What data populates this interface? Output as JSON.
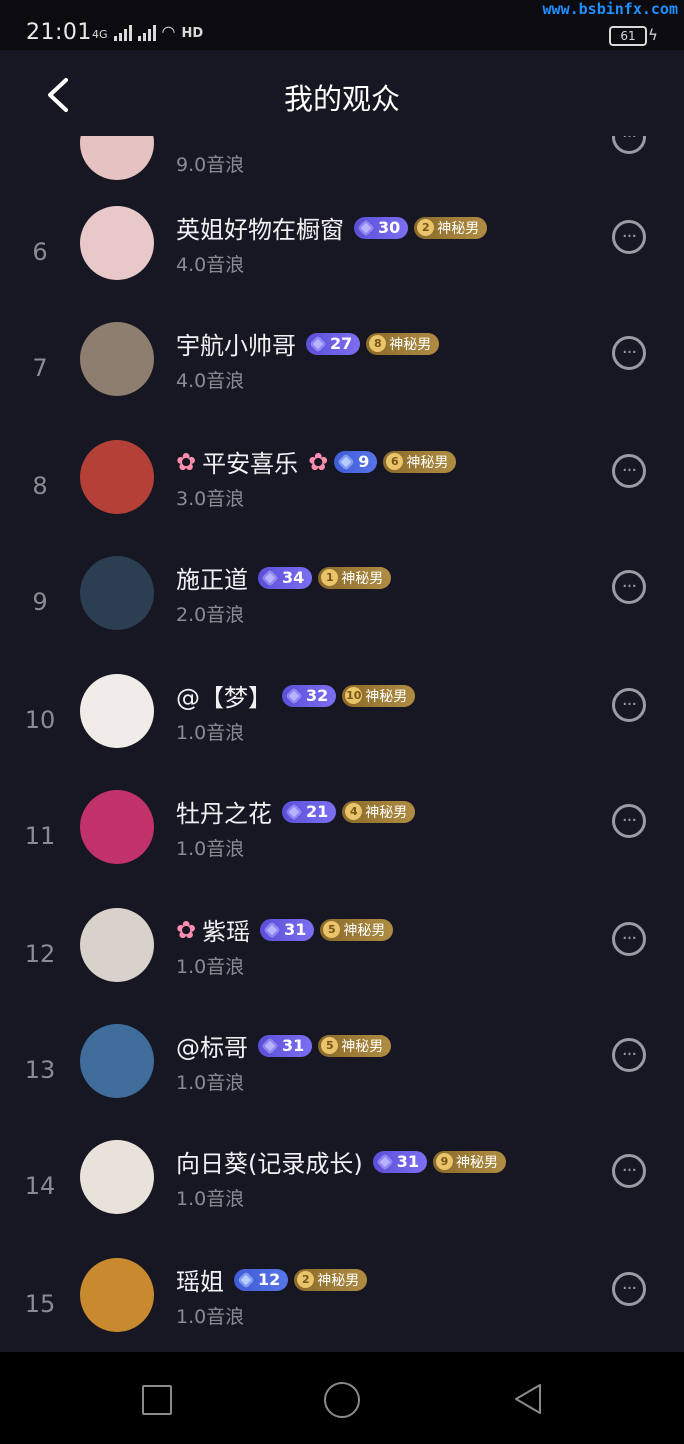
{
  "status": {
    "time": "21:01",
    "network": "4G",
    "battery": "61",
    "hd": "HD",
    "watermark": "www.bsbinfx.com"
  },
  "header": {
    "title": "我的观众"
  },
  "partial_row": {
    "amount": "9.0音浪"
  },
  "rows": [
    {
      "rank": "6",
      "name": "英姐好物在橱窗",
      "level": "30",
      "fan_level": "2",
      "fan_label": "神秘男",
      "amount": "4.0音浪",
      "flower_before": false,
      "flower_after": false,
      "level_style": "purple",
      "avatar_color": "#e8c8c8"
    },
    {
      "rank": "7",
      "name": "宇航小帅哥",
      "level": "27",
      "fan_level": "8",
      "fan_label": "神秘男",
      "amount": "4.0音浪",
      "flower_before": false,
      "flower_after": false,
      "level_style": "purple",
      "avatar_color": "#8e7e70"
    },
    {
      "rank": "8",
      "name": "平安喜乐",
      "level": "9",
      "fan_level": "6",
      "fan_label": "神秘男",
      "amount": "3.0音浪",
      "flower_before": true,
      "flower_after": true,
      "level_style": "blue",
      "avatar_color": "#b54038"
    },
    {
      "rank": "9",
      "name": "施正道",
      "level": "34",
      "fan_level": "1",
      "fan_label": "神秘男",
      "amount": "2.0音浪",
      "flower_before": false,
      "flower_after": false,
      "level_style": "purple",
      "avatar_color": "#2c3e52"
    },
    {
      "rank": "10",
      "name": "@【梦】",
      "level": "32",
      "fan_level": "10",
      "fan_label": "神秘男",
      "amount": "1.0音浪",
      "flower_before": false,
      "flower_after": false,
      "level_style": "purple",
      "avatar_color": "#f2ece8"
    },
    {
      "rank": "11",
      "name": "牡丹之花",
      "level": "21",
      "fan_level": "4",
      "fan_label": "神秘男",
      "amount": "1.0音浪",
      "flower_before": false,
      "flower_after": false,
      "level_style": "purple",
      "avatar_color": "#c2326a"
    },
    {
      "rank": "12",
      "name": "紫瑶",
      "level": "31",
      "fan_level": "5",
      "fan_label": "神秘男",
      "amount": "1.0音浪",
      "flower_before": true,
      "flower_after": false,
      "level_style": "purple",
      "avatar_color": "#d9d2cc"
    },
    {
      "rank": "13",
      "name": "@标哥",
      "level": "31",
      "fan_level": "5",
      "fan_label": "神秘男",
      "amount": "1.0音浪",
      "flower_before": false,
      "flower_after": false,
      "level_style": "purple",
      "avatar_color": "#3f6c9a"
    },
    {
      "rank": "14",
      "name": "向日葵(记录成长)",
      "level": "31",
      "fan_level": "9",
      "fan_label": "神秘男",
      "amount": "1.0音浪",
      "flower_before": false,
      "flower_after": false,
      "level_style": "purple",
      "avatar_color": "#e9e2da"
    },
    {
      "rank": "15",
      "name": "瑶姐",
      "level": "12",
      "fan_level": "2",
      "fan_label": "神秘男",
      "amount": "1.0音浪",
      "flower_before": false,
      "flower_after": false,
      "level_style": "blue",
      "avatar_color": "#c9892e"
    }
  ]
}
